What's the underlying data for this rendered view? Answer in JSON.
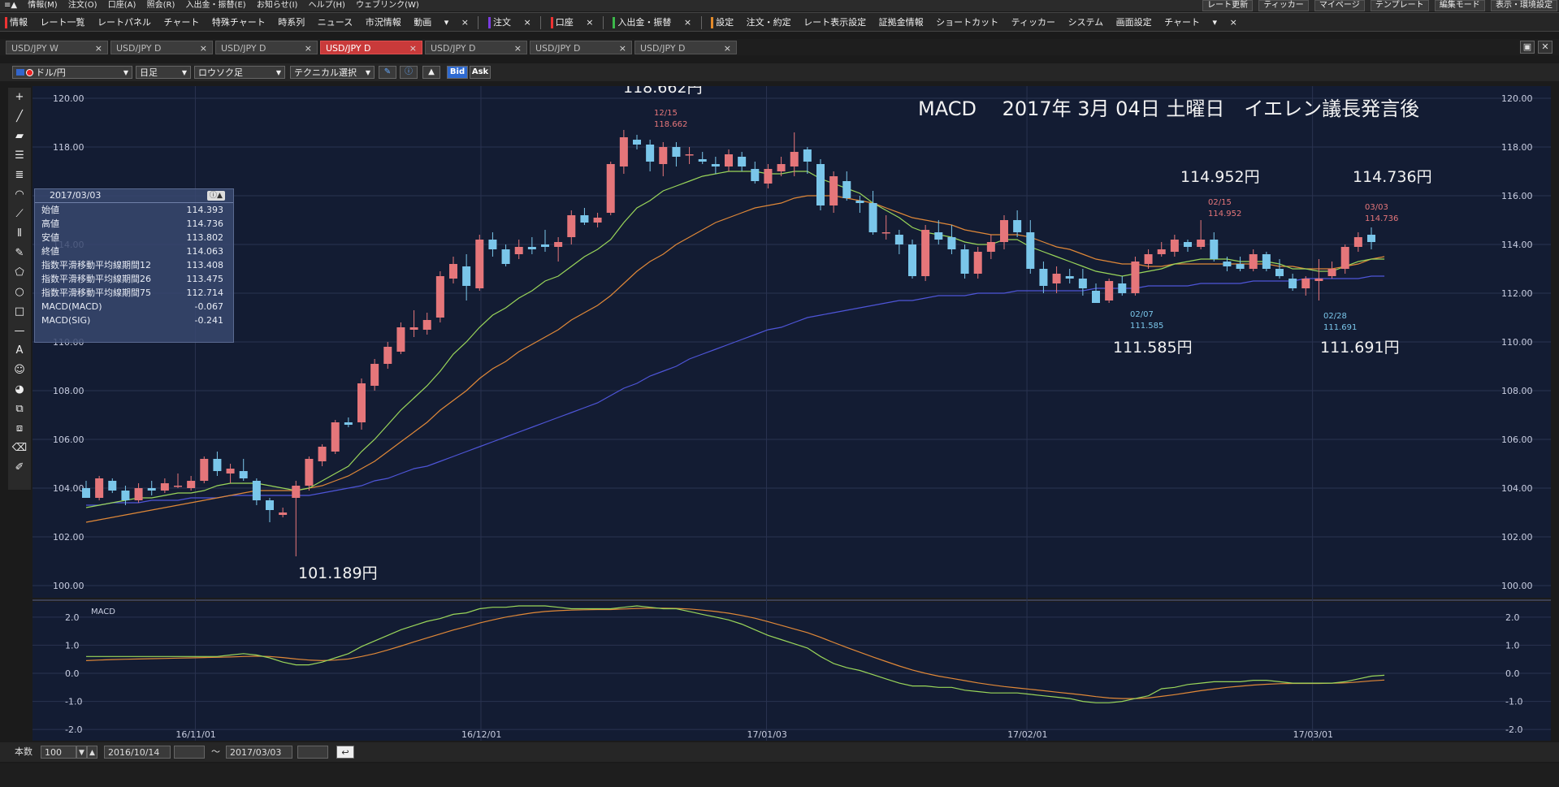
{
  "menubar": {
    "items": [
      "情報(M)",
      "注文(O)",
      "口座(A)",
      "照会(R)",
      "入出金・振替(E)",
      "お知らせ(I)",
      "ヘルプ(H)",
      "ウェブリンク(W)"
    ],
    "right_buttons": [
      "レート更新",
      "ティッカー",
      "マイページ",
      "テンプレート",
      "編集モード",
      "表示・環境設定"
    ]
  },
  "toolbar": {
    "info_label": "情報",
    "items": [
      "レート一覧",
      "レートパネル",
      "チャート",
      "特殊チャート",
      "時系列",
      "ニュース",
      "市況情報",
      "動画"
    ],
    "order_label": "注文",
    "account_label": "口座",
    "deposit_label": "入出金・振替",
    "settings_items": [
      "設定",
      "注文・約定",
      "レート表示設定",
      "証拠金情報",
      "ショートカット",
      "ティッカー",
      "システム",
      "画面設定",
      "チャート"
    ]
  },
  "tabs": [
    {
      "label": "USD/JPY W",
      "active": false
    },
    {
      "label": "USD/JPY D",
      "active": false
    },
    {
      "label": "USD/JPY D",
      "active": false
    },
    {
      "label": "USD/JPY D",
      "active": true
    },
    {
      "label": "USD/JPY D",
      "active": false
    },
    {
      "label": "USD/JPY D",
      "active": false
    },
    {
      "label": "USD/JPY D",
      "active": false
    }
  ],
  "controls": {
    "currency": "ドル/円",
    "period": "日足",
    "chart_type": "ロウソク足",
    "technical": "テクニカル選択",
    "bid": "Bid",
    "ask": "Ask"
  },
  "annotations": {
    "title": "MACD　 2017年 3月 04日 土曜日　イエレン議長発言後",
    "high_label": "118.662円",
    "low_label": "101.189円",
    "mid_high_label": "114.952円",
    "last_high_label": "114.736円",
    "low2_label": "111.585円",
    "low3_label": "111.691円",
    "small_high_date": "12/15",
    "small_high_val": "118.662",
    "small_mid_date": "02/15",
    "small_mid_val": "114.952",
    "small_last_date": "03/03",
    "small_last_val": "114.736",
    "small_low2_date": "02/07",
    "small_low2_val": "111.585",
    "small_low3_date": "02/28",
    "small_low3_val": "111.691"
  },
  "infobox": {
    "date": "2017/03/03",
    "rows": [
      {
        "label": "始値",
        "value": "114.393"
      },
      {
        "label": "高値",
        "value": "114.736"
      },
      {
        "label": "安値",
        "value": "113.802"
      },
      {
        "label": "終値",
        "value": "114.063"
      },
      {
        "label": "指数平滑移動平均線期間12",
        "value": "113.408"
      },
      {
        "label": "指数平滑移動平均線期間26",
        "value": "113.475"
      },
      {
        "label": "指数平滑移動平均線期間75",
        "value": "112.714"
      },
      {
        "label": "MACD(MACD)",
        "value": "-0.067"
      },
      {
        "label": "MACD(SIG)",
        "value": "-0.241"
      }
    ]
  },
  "status": {
    "count_label": "本数",
    "count": "100",
    "from_date": "2016/10/14",
    "tilde": "〜",
    "to_date": "2017/03/03"
  },
  "colors": {
    "bg": "#131c33",
    "up": "#e5767a",
    "down": "#7ac6ea",
    "ema12": "#9ad65a",
    "ema26": "#e08838",
    "ema75": "#4e55d8",
    "macd": "#9ad65a",
    "signal": "#e08838"
  },
  "chart_data": [
    {
      "type": "candlestick",
      "ylim": [
        99.5,
        120.5
      ],
      "yticks": [
        "120.00",
        "118.00",
        "116.00",
        "114.00",
        "112.00",
        "110.00",
        "108.00",
        "106.00",
        "104.00",
        "102.00",
        "100.00"
      ],
      "xticks": [
        "16/11/01",
        "16/12/01",
        "17/01/03",
        "17/02/01",
        "17/03/01"
      ],
      "ohlc": [
        [
          104.0,
          104.3,
          103.6,
          103.6
        ],
        [
          103.6,
          104.5,
          103.5,
          104.4
        ],
        [
          104.3,
          104.4,
          103.8,
          103.9
        ],
        [
          103.9,
          104.1,
          103.3,
          103.5
        ],
        [
          103.5,
          104.2,
          103.4,
          104.0
        ],
        [
          104.0,
          104.3,
          103.7,
          103.9
        ],
        [
          103.9,
          104.4,
          103.8,
          104.2
        ],
        [
          104.1,
          104.6,
          104.0,
          104.1
        ],
        [
          104.0,
          104.5,
          103.9,
          104.3
        ],
        [
          104.3,
          105.3,
          104.2,
          105.2
        ],
        [
          105.2,
          105.5,
          104.5,
          104.7
        ],
        [
          104.6,
          105.0,
          104.2,
          104.8
        ],
        [
          104.7,
          105.2,
          104.3,
          104.4
        ],
        [
          104.3,
          104.4,
          103.3,
          103.5
        ],
        [
          103.5,
          103.6,
          102.6,
          103.1
        ],
        [
          102.9,
          103.2,
          102.8,
          103.0
        ],
        [
          103.6,
          104.3,
          101.2,
          104.1
        ],
        [
          104.1,
          105.3,
          103.9,
          105.2
        ],
        [
          105.1,
          105.8,
          104.9,
          105.7
        ],
        [
          105.5,
          106.8,
          105.4,
          106.7
        ],
        [
          106.7,
          106.9,
          106.5,
          106.6
        ],
        [
          106.7,
          108.5,
          106.4,
          108.3
        ],
        [
          108.2,
          109.3,
          108.0,
          109.1
        ],
        [
          109.1,
          110.0,
          108.9,
          109.8
        ],
        [
          109.6,
          110.8,
          109.5,
          110.6
        ],
        [
          110.5,
          111.3,
          110.2,
          110.6
        ],
        [
          110.5,
          111.2,
          110.3,
          110.9
        ],
        [
          111.0,
          112.9,
          110.8,
          112.7
        ],
        [
          112.6,
          113.5,
          112.4,
          113.2
        ],
        [
          113.1,
          113.6,
          111.7,
          112.3
        ],
        [
          112.2,
          114.4,
          112.1,
          114.2
        ],
        [
          114.2,
          114.5,
          113.5,
          113.8
        ],
        [
          113.8,
          114.0,
          113.1,
          113.2
        ],
        [
          113.6,
          114.2,
          113.4,
          113.9
        ],
        [
          113.9,
          114.3,
          113.6,
          113.8
        ],
        [
          114.0,
          114.6,
          113.7,
          113.9
        ],
        [
          113.9,
          114.3,
          113.3,
          114.1
        ],
        [
          114.3,
          115.4,
          114.0,
          115.2
        ],
        [
          115.2,
          115.5,
          114.8,
          114.9
        ],
        [
          114.9,
          115.3,
          114.7,
          115.1
        ],
        [
          115.3,
          117.4,
          115.2,
          117.3
        ],
        [
          117.2,
          118.7,
          116.9,
          118.4
        ],
        [
          118.3,
          118.5,
          117.9,
          118.1
        ],
        [
          118.1,
          118.3,
          117.0,
          117.4
        ],
        [
          117.3,
          118.2,
          116.8,
          118.0
        ],
        [
          118.0,
          118.2,
          117.2,
          117.6
        ],
        [
          117.7,
          118.0,
          117.3,
          117.7
        ],
        [
          117.5,
          117.8,
          117.3,
          117.4
        ],
        [
          117.3,
          117.6,
          116.9,
          117.2
        ],
        [
          117.2,
          117.9,
          117.0,
          117.7
        ],
        [
          117.6,
          117.8,
          117.0,
          117.2
        ],
        [
          117.1,
          117.4,
          116.5,
          116.6
        ],
        [
          116.5,
          117.3,
          116.3,
          117.1
        ],
        [
          117.0,
          117.6,
          116.8,
          117.3
        ],
        [
          117.2,
          118.6,
          116.8,
          117.8
        ],
        [
          117.9,
          118.0,
          116.9,
          117.4
        ],
        [
          117.3,
          117.5,
          115.4,
          115.6
        ],
        [
          115.6,
          117.0,
          115.3,
          116.8
        ],
        [
          116.6,
          117.0,
          115.8,
          115.9
        ],
        [
          115.8,
          116.0,
          115.3,
          115.7
        ],
        [
          115.7,
          116.2,
          114.4,
          114.5
        ],
        [
          114.5,
          115.2,
          114.2,
          114.5
        ],
        [
          114.4,
          114.6,
          113.6,
          114.0
        ],
        [
          114.0,
          114.2,
          112.6,
          112.7
        ],
        [
          112.7,
          114.8,
          112.5,
          114.6
        ],
        [
          114.5,
          115.0,
          114.0,
          114.2
        ],
        [
          114.3,
          114.8,
          113.6,
          113.8
        ],
        [
          113.8,
          114.0,
          112.6,
          112.8
        ],
        [
          112.8,
          113.9,
          112.6,
          113.7
        ],
        [
          113.7,
          114.4,
          113.4,
          114.1
        ],
        [
          114.1,
          115.2,
          113.8,
          115.0
        ],
        [
          115.0,
          115.4,
          114.3,
          114.5
        ],
        [
          114.5,
          115.0,
          112.8,
          113.0
        ],
        [
          113.0,
          113.3,
          112.0,
          112.3
        ],
        [
          112.4,
          113.1,
          112.0,
          112.8
        ],
        [
          112.7,
          113.0,
          112.4,
          112.6
        ],
        [
          112.6,
          113.0,
          111.9,
          112.2
        ],
        [
          112.1,
          112.4,
          111.6,
          111.6
        ],
        [
          111.7,
          112.6,
          111.6,
          112.5
        ],
        [
          112.4,
          112.7,
          111.9,
          112.0
        ],
        [
          112.0,
          113.5,
          111.9,
          113.3
        ],
        [
          113.2,
          113.8,
          113.0,
          113.6
        ],
        [
          113.6,
          114.1,
          113.5,
          113.8
        ],
        [
          113.7,
          114.4,
          113.5,
          114.2
        ],
        [
          114.1,
          114.2,
          113.7,
          113.9
        ],
        [
          113.9,
          115.0,
          113.8,
          114.2
        ],
        [
          114.2,
          114.5,
          113.3,
          113.4
        ],
        [
          113.3,
          113.5,
          112.9,
          113.1
        ],
        [
          113.2,
          113.5,
          112.9,
          113.0
        ],
        [
          113.0,
          113.8,
          112.9,
          113.6
        ],
        [
          113.6,
          113.7,
          112.9,
          113.0
        ],
        [
          113.0,
          113.4,
          112.6,
          112.7
        ],
        [
          112.6,
          112.8,
          112.1,
          112.2
        ],
        [
          112.2,
          112.7,
          111.9,
          112.6
        ],
        [
          112.5,
          113.4,
          111.7,
          112.6
        ],
        [
          112.7,
          113.3,
          112.6,
          113.0
        ],
        [
          113.0,
          114.0,
          112.8,
          113.9
        ],
        [
          113.9,
          114.5,
          113.7,
          114.3
        ],
        [
          114.4,
          114.7,
          113.8,
          114.1
        ]
      ],
      "ema12": [
        103.2,
        103.3,
        103.4,
        103.5,
        103.6,
        103.6,
        103.7,
        103.8,
        103.8,
        103.9,
        104.1,
        104.2,
        104.2,
        104.2,
        104.1,
        104.0,
        103.9,
        104.0,
        104.3,
        104.6,
        104.9,
        105.5,
        106.0,
        106.6,
        107.2,
        107.7,
        108.2,
        108.8,
        109.5,
        110.0,
        110.6,
        111.1,
        111.4,
        111.8,
        112.1,
        112.5,
        112.7,
        113.1,
        113.5,
        113.8,
        114.2,
        114.9,
        115.5,
        115.8,
        116.2,
        116.4,
        116.6,
        116.8,
        116.9,
        117.0,
        117.0,
        117.0,
        116.9,
        116.9,
        117.0,
        117.0,
        116.7,
        116.5,
        116.3,
        116.1,
        115.7,
        115.4,
        115.1,
        114.7,
        114.5,
        114.4,
        114.3,
        114.1,
        114.0,
        114.0,
        114.2,
        114.2,
        113.9,
        113.7,
        113.5,
        113.3,
        113.1,
        112.9,
        112.8,
        112.7,
        112.8,
        112.9,
        113.0,
        113.2,
        113.3,
        113.4,
        113.4,
        113.4,
        113.3,
        113.3,
        113.3,
        113.2,
        113.0,
        113.0,
        112.9,
        112.9,
        113.1,
        113.3,
        113.4,
        113.4
      ],
      "ema26": [
        102.6,
        102.7,
        102.8,
        102.9,
        103.0,
        103.1,
        103.2,
        103.3,
        103.4,
        103.5,
        103.6,
        103.7,
        103.8,
        103.9,
        103.9,
        103.9,
        103.9,
        104.0,
        104.1,
        104.3,
        104.5,
        104.8,
        105.1,
        105.5,
        105.9,
        106.3,
        106.7,
        107.2,
        107.6,
        108.0,
        108.5,
        108.9,
        109.2,
        109.6,
        109.9,
        110.2,
        110.5,
        110.9,
        111.2,
        111.5,
        111.9,
        112.4,
        112.9,
        113.3,
        113.6,
        114.0,
        114.3,
        114.6,
        114.9,
        115.1,
        115.3,
        115.5,
        115.6,
        115.7,
        115.9,
        116.0,
        116.0,
        116.0,
        115.9,
        115.8,
        115.7,
        115.5,
        115.3,
        115.1,
        115.0,
        114.9,
        114.8,
        114.6,
        114.5,
        114.4,
        114.4,
        114.4,
        114.3,
        114.1,
        113.9,
        113.8,
        113.6,
        113.4,
        113.3,
        113.2,
        113.2,
        113.1,
        113.1,
        113.2,
        113.2,
        113.2,
        113.2,
        113.2,
        113.2,
        113.2,
        113.2,
        113.1,
        113.1,
        113.0,
        113.0,
        113.0,
        113.1,
        113.2,
        113.4,
        113.5
      ],
      "ema75": [
        103.3,
        103.3,
        103.4,
        103.4,
        103.4,
        103.5,
        103.5,
        103.5,
        103.6,
        103.6,
        103.6,
        103.7,
        103.7,
        103.7,
        103.7,
        103.7,
        103.7,
        103.7,
        103.8,
        103.9,
        104.0,
        104.1,
        104.3,
        104.4,
        104.6,
        104.8,
        104.9,
        105.1,
        105.3,
        105.5,
        105.7,
        105.9,
        106.1,
        106.3,
        106.5,
        106.7,
        106.9,
        107.1,
        107.3,
        107.5,
        107.8,
        108.1,
        108.3,
        108.6,
        108.8,
        109.0,
        109.3,
        109.5,
        109.7,
        109.9,
        110.1,
        110.3,
        110.5,
        110.6,
        110.8,
        111.0,
        111.1,
        111.2,
        111.3,
        111.4,
        111.5,
        111.6,
        111.7,
        111.7,
        111.8,
        111.9,
        111.9,
        111.9,
        112.0,
        112.0,
        112.0,
        112.1,
        112.1,
        112.1,
        112.1,
        112.1,
        112.1,
        112.2,
        112.2,
        112.2,
        112.2,
        112.3,
        112.3,
        112.3,
        112.3,
        112.4,
        112.4,
        112.4,
        112.4,
        112.5,
        112.5,
        112.5,
        112.5,
        112.6,
        112.6,
        112.6,
        112.6,
        112.6,
        112.7,
        112.7
      ]
    },
    {
      "type": "line",
      "title": "MACD",
      "ylim": [
        -2.4,
        2.4
      ],
      "yticks": [
        "2.0",
        "1.0",
        "0.0",
        "-1.0",
        "-2.0"
      ],
      "macd": [
        0.6,
        0.6,
        0.6,
        0.6,
        0.6,
        0.6,
        0.6,
        0.6,
        0.6,
        0.6,
        0.6,
        0.65,
        0.7,
        0.65,
        0.55,
        0.4,
        0.3,
        0.3,
        0.4,
        0.55,
        0.7,
        0.95,
        1.15,
        1.35,
        1.55,
        1.7,
        1.85,
        1.95,
        2.1,
        2.15,
        2.3,
        2.35,
        2.35,
        2.4,
        2.4,
        2.4,
        2.35,
        2.3,
        2.3,
        2.3,
        2.3,
        2.35,
        2.4,
        2.35,
        2.3,
        2.3,
        2.2,
        2.1,
        2.0,
        1.9,
        1.75,
        1.55,
        1.35,
        1.2,
        1.05,
        0.9,
        0.6,
        0.35,
        0.2,
        0.1,
        -0.05,
        -0.2,
        -0.35,
        -0.45,
        -0.45,
        -0.5,
        -0.5,
        -0.6,
        -0.65,
        -0.7,
        -0.7,
        -0.7,
        -0.75,
        -0.8,
        -0.85,
        -0.9,
        -1.0,
        -1.05,
        -1.05,
        -1.0,
        -0.9,
        -0.8,
        -0.55,
        -0.5,
        -0.4,
        -0.35,
        -0.3,
        -0.3,
        -0.3,
        -0.25,
        -0.25,
        -0.3,
        -0.35,
        -0.35,
        -0.35,
        -0.35,
        -0.3,
        -0.2,
        -0.1,
        -0.07
      ],
      "signal": [
        0.45,
        0.47,
        0.49,
        0.5,
        0.51,
        0.52,
        0.53,
        0.54,
        0.55,
        0.56,
        0.57,
        0.58,
        0.6,
        0.61,
        0.6,
        0.56,
        0.51,
        0.47,
        0.45,
        0.47,
        0.51,
        0.6,
        0.7,
        0.83,
        0.97,
        1.12,
        1.26,
        1.4,
        1.54,
        1.66,
        1.79,
        1.9,
        2.0,
        2.08,
        2.15,
        2.2,
        2.23,
        2.25,
        2.26,
        2.27,
        2.27,
        2.29,
        2.31,
        2.32,
        2.32,
        2.31,
        2.29,
        2.25,
        2.2,
        2.14,
        2.06,
        1.96,
        1.84,
        1.71,
        1.58,
        1.45,
        1.28,
        1.1,
        0.92,
        0.75,
        0.58,
        0.42,
        0.26,
        0.12,
        0.0,
        -0.1,
        -0.18,
        -0.26,
        -0.34,
        -0.41,
        -0.47,
        -0.52,
        -0.57,
        -0.62,
        -0.67,
        -0.72,
        -0.77,
        -0.83,
        -0.88,
        -0.9,
        -0.9,
        -0.88,
        -0.82,
        -0.76,
        -0.69,
        -0.62,
        -0.56,
        -0.5,
        -0.46,
        -0.42,
        -0.39,
        -0.37,
        -0.36,
        -0.36,
        -0.36,
        -0.35,
        -0.34,
        -0.31,
        -0.27,
        -0.24
      ]
    }
  ]
}
